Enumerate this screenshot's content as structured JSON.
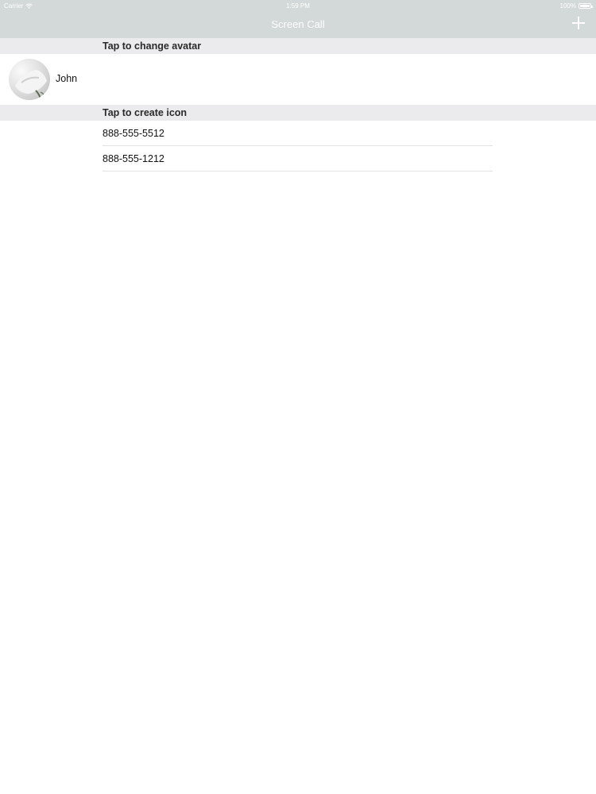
{
  "status_bar": {
    "carrier": "Carrier",
    "time": "1:59 PM",
    "battery_text": "100%",
    "battery_level": 1.0
  },
  "nav": {
    "title": "Screen Call",
    "add_icon": "plus-icon"
  },
  "sections": {
    "avatar_header": "Tap to change avatar",
    "icon_header": "Tap to create icon"
  },
  "contact": {
    "name": "John",
    "avatar_icon": "avatar-photo"
  },
  "phones": [
    "888-555-5512",
    "888-555-1212"
  ],
  "colors": {
    "bar_background": "#d2d9d8",
    "section_background": "#ebebed"
  }
}
